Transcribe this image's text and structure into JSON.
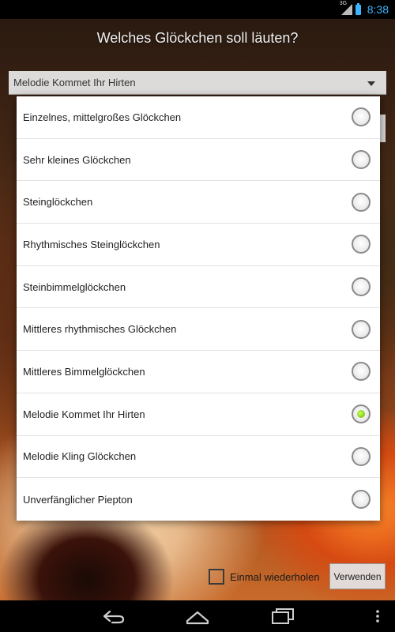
{
  "status_bar": {
    "network": "3G",
    "time": "8:38",
    "icons": [
      "signal-icon",
      "battery-icon"
    ]
  },
  "header": {
    "title": "Welches Glöckchen soll läuten?"
  },
  "spinner": {
    "selected": "Melodie Kommet Ihr Hirten"
  },
  "dialog": {
    "options": [
      {
        "label": "Einzelnes, mittelgroßes Glöckchen",
        "checked": false
      },
      {
        "label": "Sehr kleines Glöckchen",
        "checked": false
      },
      {
        "label": "Steinglöckchen",
        "checked": false
      },
      {
        "label": "Rhythmisches Steinglöckchen",
        "checked": false
      },
      {
        "label": "Steinbimmelglöckchen",
        "checked": false
      },
      {
        "label": "Mittleres rhythmisches Glöckchen",
        "checked": false
      },
      {
        "label": "Mittleres Bimmelglöckchen",
        "checked": false
      },
      {
        "label": "Melodie Kommet Ihr Hirten",
        "checked": true
      },
      {
        "label": "Melodie Kling Glöckchen",
        "checked": false
      },
      {
        "label": "Unverfänglicher Piepton",
        "checked": false
      }
    ],
    "accent_color": "#8bd41a"
  },
  "footer": {
    "repeat_label": "Einmal wiederholen",
    "repeat_checked": false,
    "use_label": "Verwenden"
  },
  "nav_bar": {
    "icons": [
      "back-icon",
      "home-icon",
      "recents-icon",
      "menu-icon"
    ]
  },
  "colors": {
    "status_accent": "#3db4ff"
  }
}
